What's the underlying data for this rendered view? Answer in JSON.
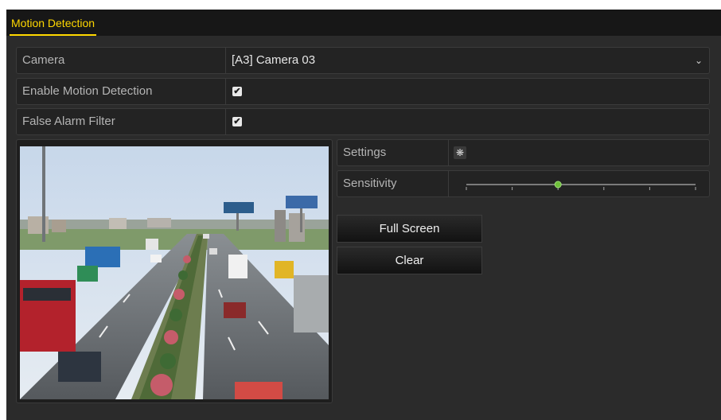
{
  "tab": {
    "label": "Motion Detection"
  },
  "camera": {
    "label": "Camera",
    "value": "[A3] Camera 03"
  },
  "enable_motion": {
    "label": "Enable Motion Detection",
    "checked": true
  },
  "false_alarm": {
    "label": "False Alarm Filter",
    "checked": true
  },
  "settings": {
    "label": "Settings",
    "icon": "gear-icon"
  },
  "sensitivity": {
    "label": "Sensitivity",
    "level": 0.4,
    "ticks": 6
  },
  "buttons": {
    "full_screen": "Full Screen",
    "clear": "Clear"
  },
  "colors": {
    "accent": "#ffd800",
    "panel": "#2b2b2b",
    "slider_knob": "#6fbf3a"
  }
}
